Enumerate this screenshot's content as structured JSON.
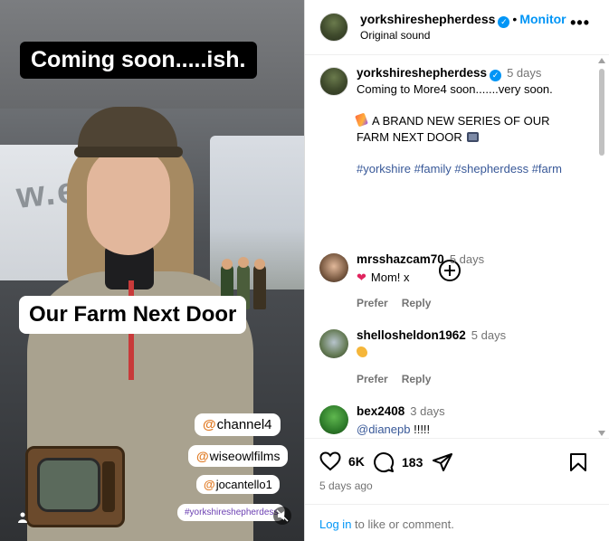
{
  "media": {
    "caption_top": "Coming soon.....ish.",
    "caption_mid": "Our Farm Next Door",
    "background_text": "w.ell",
    "tags": [
      {
        "text": "channel4"
      },
      {
        "text": "wiseowlfilms"
      },
      {
        "text": "jocantello1"
      },
      {
        "text": "#yorkshireshepherdess"
      }
    ],
    "tag_at_symbol": "@"
  },
  "header": {
    "username": "yorkshireshepherdess",
    "verified_icon": "✓",
    "separator": "•",
    "follow_label": "Monitor",
    "audio_label": "Original sound",
    "more_label": "•••"
  },
  "post": {
    "username": "yorkshireshepherdess",
    "time": "5 days",
    "lines": {
      "l1": "Coming to More4 soon.......very soon.",
      "l2": "A BRAND NEW SERIES OF OUR",
      "l3": "FARM NEXT DOOR"
    },
    "hashtags": [
      "#yorkshire",
      "#family",
      "#shepherdess",
      "#farm"
    ]
  },
  "comments": [
    {
      "user": "mrsshazcam70",
      "time": "5 days",
      "text": "Mom! x",
      "like_label": "Prefer",
      "reply_label": "Reply"
    },
    {
      "user": "shellosheldon1962",
      "time": "5 days",
      "text": "",
      "like_label": "Prefer",
      "reply_label": "Reply"
    },
    {
      "user": "bex2408",
      "time": "3 days",
      "mention": "@dianepb",
      "text": "!!!!!"
    }
  ],
  "actions": {
    "likes": "6K",
    "comments": "183"
  },
  "posted_time": "5 days ago",
  "footer": {
    "login_link": "Log in",
    "login_rest": " to like or comment."
  },
  "colors": {
    "accent": "#0095f6",
    "verified": "#0095f6",
    "secondary_text": "#737373",
    "hashtag": "#385898",
    "caption_bg_dark": "#000000"
  },
  "icons": {
    "heart": "heart-icon",
    "comment": "comment-icon",
    "share": "share-icon",
    "save": "bookmark-icon",
    "add": "plus-circle-icon",
    "more": "more-options-icon"
  }
}
